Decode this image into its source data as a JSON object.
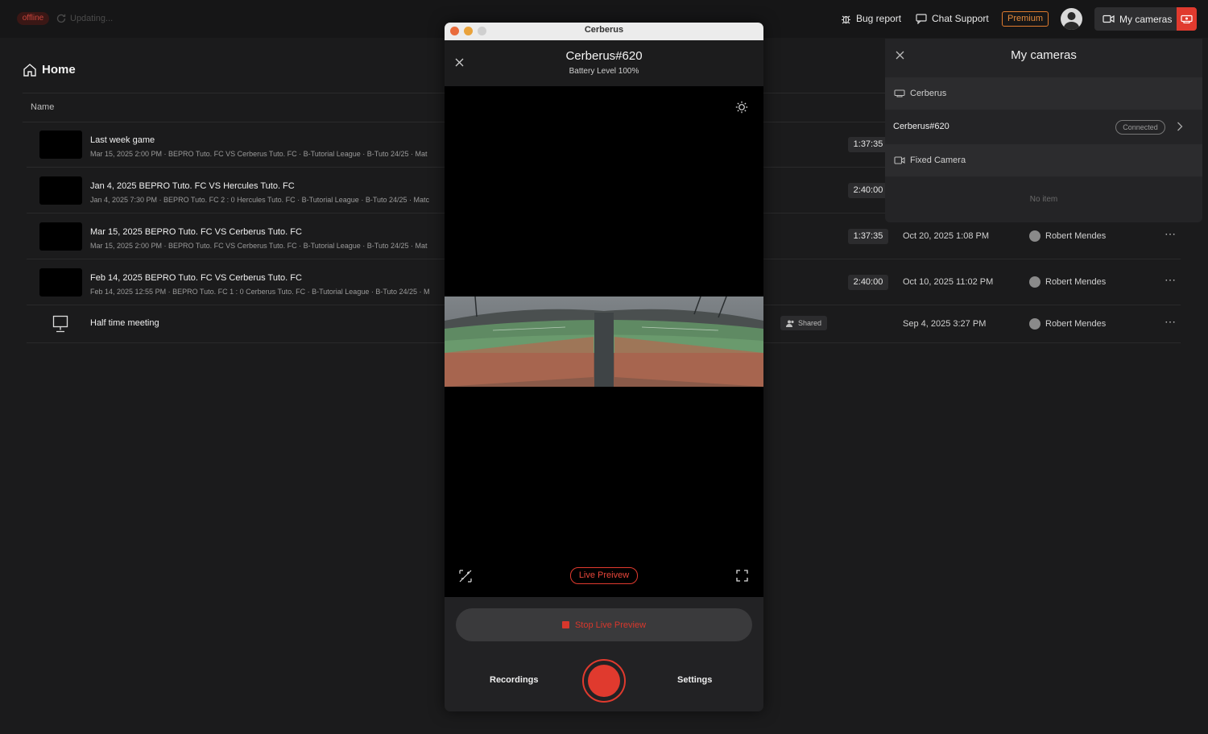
{
  "topbar": {
    "status": "offline",
    "updating": "Updating...",
    "bug_report": "Bug report",
    "chat_support": "Chat Support",
    "premium": "Premium",
    "my_cameras": "My cameras"
  },
  "home": {
    "title": "Home",
    "column_name": "Name",
    "rows": [
      {
        "title": "Last week game",
        "sub": "Mar 15, 2025 2:00 PM · BEPRO Tuto. FC VS Cerberus Tuto. FC · B-Tutorial League · B-Tuto 24/25 · Mat",
        "duration": "1:37:35",
        "date": "",
        "owner": ""
      },
      {
        "title": "Jan 4, 2025 BEPRO Tuto. FC VS Hercules Tuto. FC",
        "sub": "Jan 4, 2025 7:30 PM · BEPRO Tuto. FC 2 : 0 Hercules Tuto. FC · B-Tutorial League · B-Tuto 24/25 · Matc",
        "duration": "2:40:00",
        "date": "",
        "owner": ""
      },
      {
        "title": "Mar 15, 2025 BEPRO Tuto. FC VS Cerberus Tuto. FC",
        "sub": "Mar 15, 2025 2:00 PM · BEPRO Tuto. FC VS Cerberus Tuto. FC · B-Tutorial League · B-Tuto 24/25 · Mat",
        "duration": "1:37:35",
        "date": "Oct 20, 2025 1:08 PM",
        "owner": "Robert Mendes"
      },
      {
        "title": "Feb 14, 2025 BEPRO Tuto. FC VS Cerberus Tuto. FC",
        "sub": "Feb 14, 2025 12:55 PM · BEPRO Tuto. FC 1 : 0 Cerberus Tuto. FC · B-Tutorial League · B-Tuto 24/25 · M",
        "duration": "2:40:00",
        "date": "Oct 10, 2025 11:02 PM",
        "owner": "Robert Mendes"
      },
      {
        "title": "Half time meeting",
        "shared": "Shared",
        "date": "Sep 4, 2025 3:27 PM",
        "owner": "Robert Mendes"
      }
    ]
  },
  "cameras_panel": {
    "title": "My cameras",
    "section_cerberus": "Cerberus",
    "camera_name": "Cerberus#620",
    "camera_status": "Connected",
    "section_fixed": "Fixed Camera",
    "empty": "No item"
  },
  "window": {
    "title": "Cerberus",
    "camera_name": "Cerberus#620",
    "battery": "Battery Level 100%",
    "live_preview": "Live Preivew",
    "stop_live_preview": "Stop Live Preview",
    "recordings": "Recordings",
    "settings": "Settings"
  },
  "colors": {
    "accent_red": "#e03a2e",
    "premium_orange": "#e07b2e",
    "background": "#1b1b1c"
  }
}
